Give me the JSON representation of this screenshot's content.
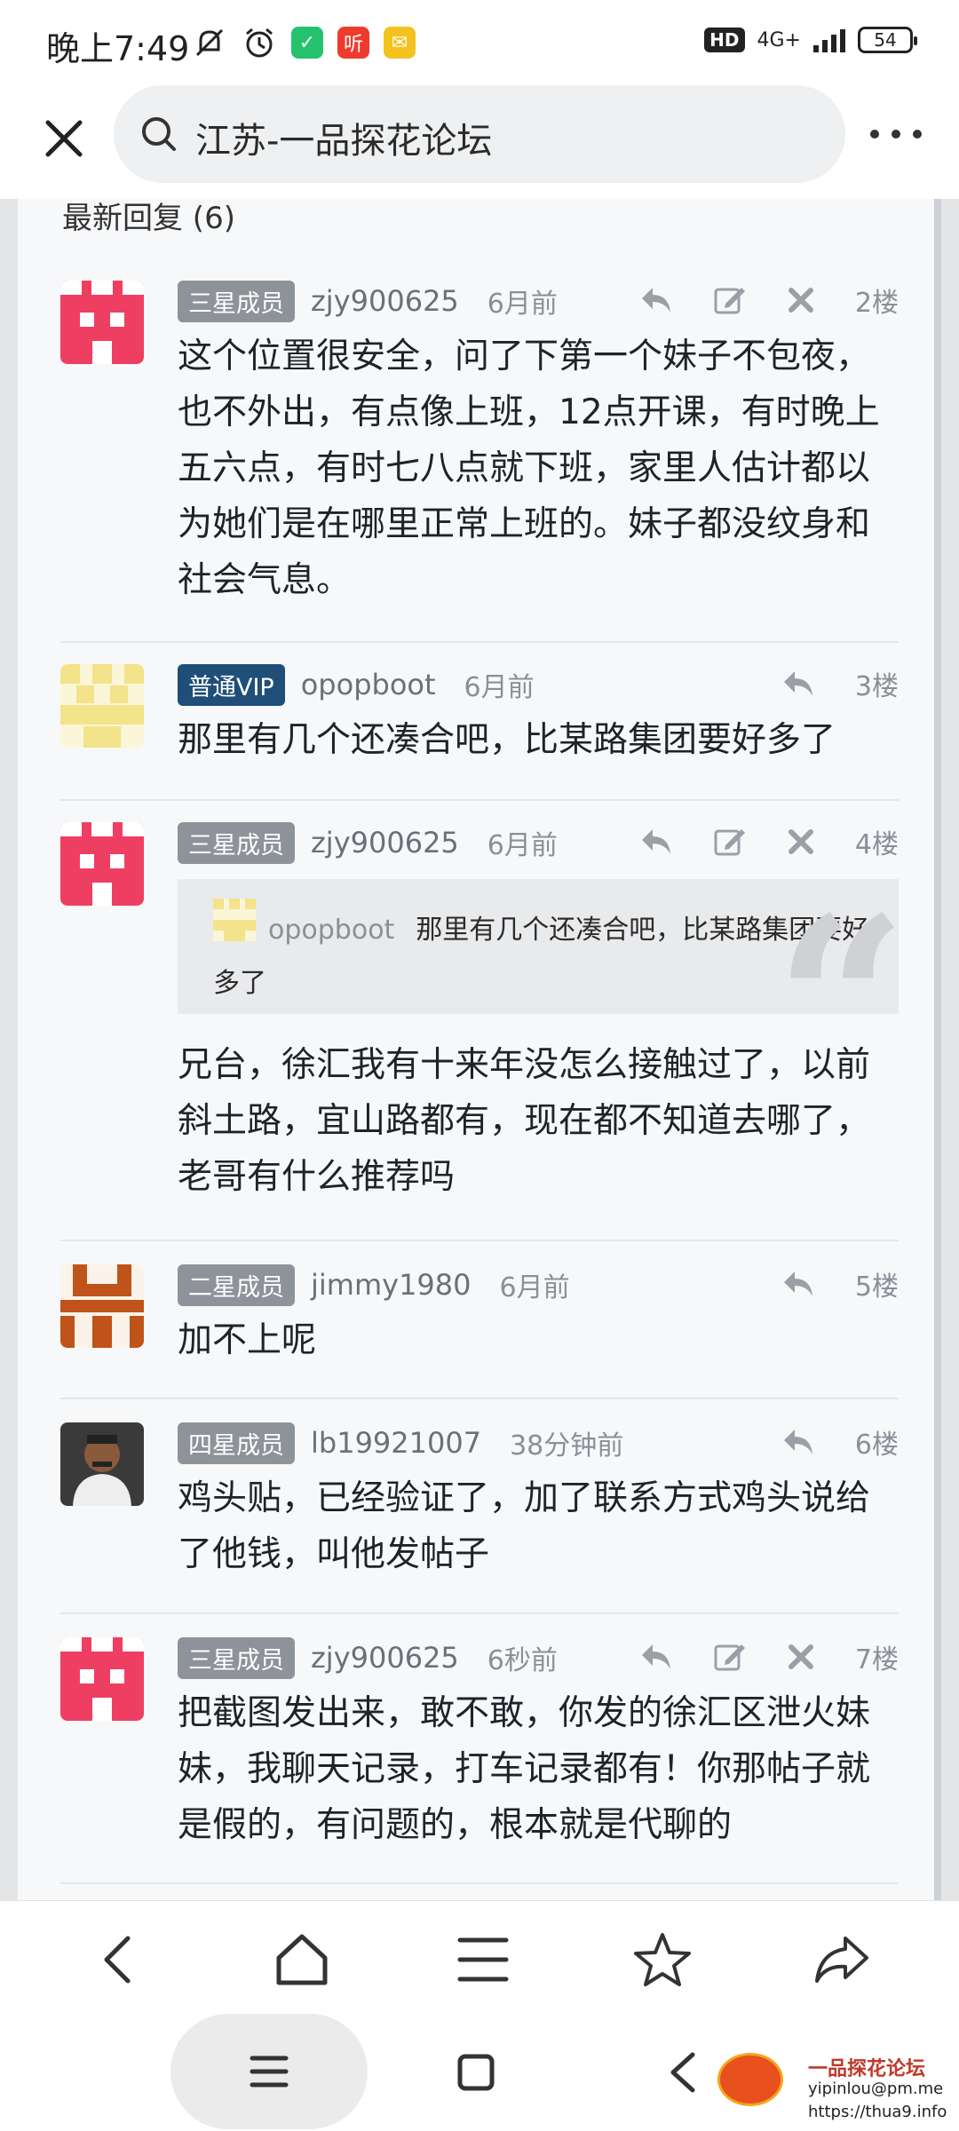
{
  "status_bar": {
    "time": "晚上7:49",
    "app_badge_1": "",
    "app_badge_2": "听",
    "hd": "HD",
    "network": "4G+",
    "battery": "54"
  },
  "header": {
    "search_text": "江苏-一品探花论坛"
  },
  "section_title": "最新回复 (6)",
  "posts": [
    {
      "rank": "三星成员",
      "rank_color": "#8e9399",
      "user": "zjy900625",
      "time": "6月前",
      "floor": "2楼",
      "content": "这个位置很安全，问了下第一个妹子不包夜，也不外出，有点像上班，12点开课，有时晚上五六点，有时七八点就下班，家里人估计都以为她们是在哪里正常上班的。妹子都没纹身和社会气息。"
    },
    {
      "rank": "普通VIP",
      "rank_color": "#1f4e79",
      "user": "opopboot",
      "time": "6月前",
      "floor": "3楼",
      "content": "那里有几个还凑合吧，比某路集团要好多了"
    },
    {
      "rank": "三星成员",
      "rank_color": "#8e9399",
      "user": "zjy900625",
      "time": "6月前",
      "floor": "4楼",
      "quote_user": "opopboot",
      "quote_text": "那里有几个还凑合吧，比某路集团要好多了",
      "content": "兄台，徐汇我有十来年没怎么接触过了，以前斜土路，宜山路都有，现在都不知道去哪了，老哥有什么推荐吗"
    },
    {
      "rank": "二星成员",
      "rank_color": "#8e9399",
      "user": "jimmy1980",
      "time": "6月前",
      "floor": "5楼",
      "content": "加不上呢"
    },
    {
      "rank": "四星成员",
      "rank_color": "#8e9399",
      "user": "lb19921007",
      "time": "38分钟前",
      "floor": "6楼",
      "content": "鸡头贴，已经验证了，加了联系方式鸡头说给了他钱，叫他发帖子"
    },
    {
      "rank": "三星成员",
      "rank_color": "#8e9399",
      "user": "zjy900625",
      "time": "6秒前",
      "floor": "7楼",
      "content": "把截图发出来，敢不敢，你发的徐汇区泄火妹妹，我聊天记录，打车记录都有！你那帖子就是假的，有问题的，根本就是代聊的"
    }
  ],
  "watermark": {
    "title": "一品探花论坛",
    "email": "yipinlou@pm.me",
    "url": "https://thua9.info"
  }
}
